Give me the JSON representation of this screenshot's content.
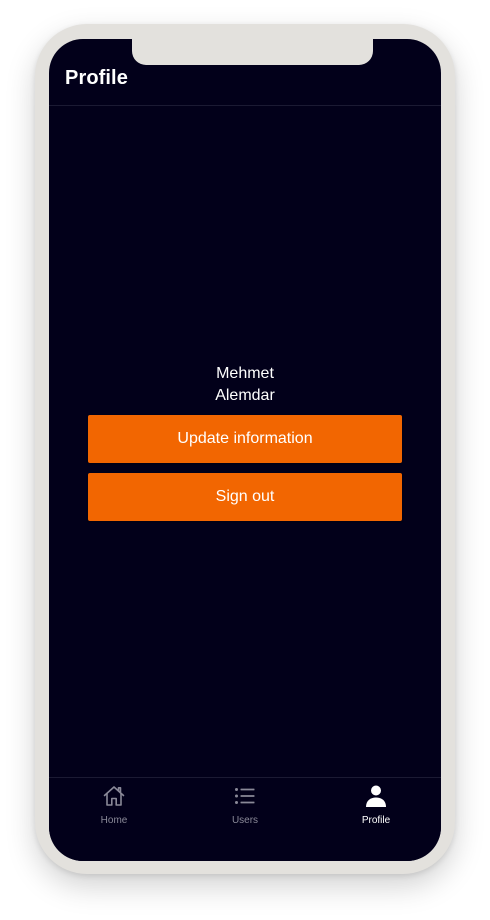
{
  "header": {
    "title": "Profile"
  },
  "user": {
    "first_name": "Mehmet",
    "last_name": "Alemdar"
  },
  "actions": {
    "update_label": "Update information",
    "signout_label": "Sign out"
  },
  "tabbar": {
    "items": [
      {
        "label": "Home",
        "icon": "home-icon",
        "active": false
      },
      {
        "label": "Users",
        "icon": "list-icon",
        "active": false
      },
      {
        "label": "Profile",
        "icon": "person-icon",
        "active": true
      }
    ]
  },
  "colors": {
    "background": "#02001a",
    "accent": "#f26601",
    "frame": "#e3e1dd",
    "inactive_tab": "#8a8998"
  }
}
